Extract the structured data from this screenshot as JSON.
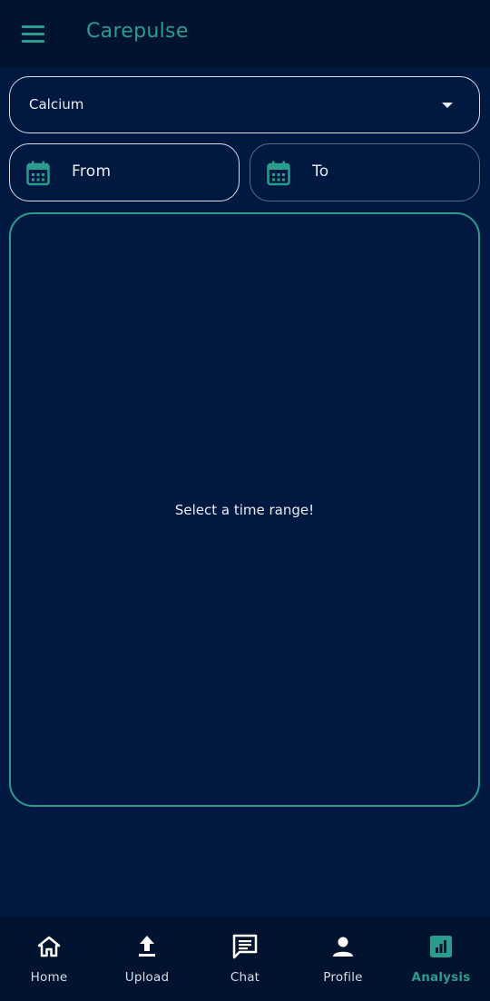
{
  "app": {
    "title": "Carepulse",
    "accent_color": "#2a9d8f",
    "background_color": "#011941"
  },
  "header": {
    "menu_icon": "hamburger-menu-icon"
  },
  "analysis": {
    "selected_metric": "Calcium",
    "dropdown_icon": "caret-down-icon",
    "from_label": "From",
    "to_label": "To",
    "date_icon": "calendar-icon",
    "empty_message": "Select a time range!"
  },
  "bottom_nav": {
    "items": [
      {
        "label": "Home",
        "icon": "home-icon"
      },
      {
        "label": "Upload",
        "icon": "upload-icon"
      },
      {
        "label": "Chat",
        "icon": "chat-icon"
      },
      {
        "label": "Profile",
        "icon": "profile-icon"
      },
      {
        "label": "Analysis",
        "icon": "analysis-icon",
        "active": true
      }
    ]
  }
}
